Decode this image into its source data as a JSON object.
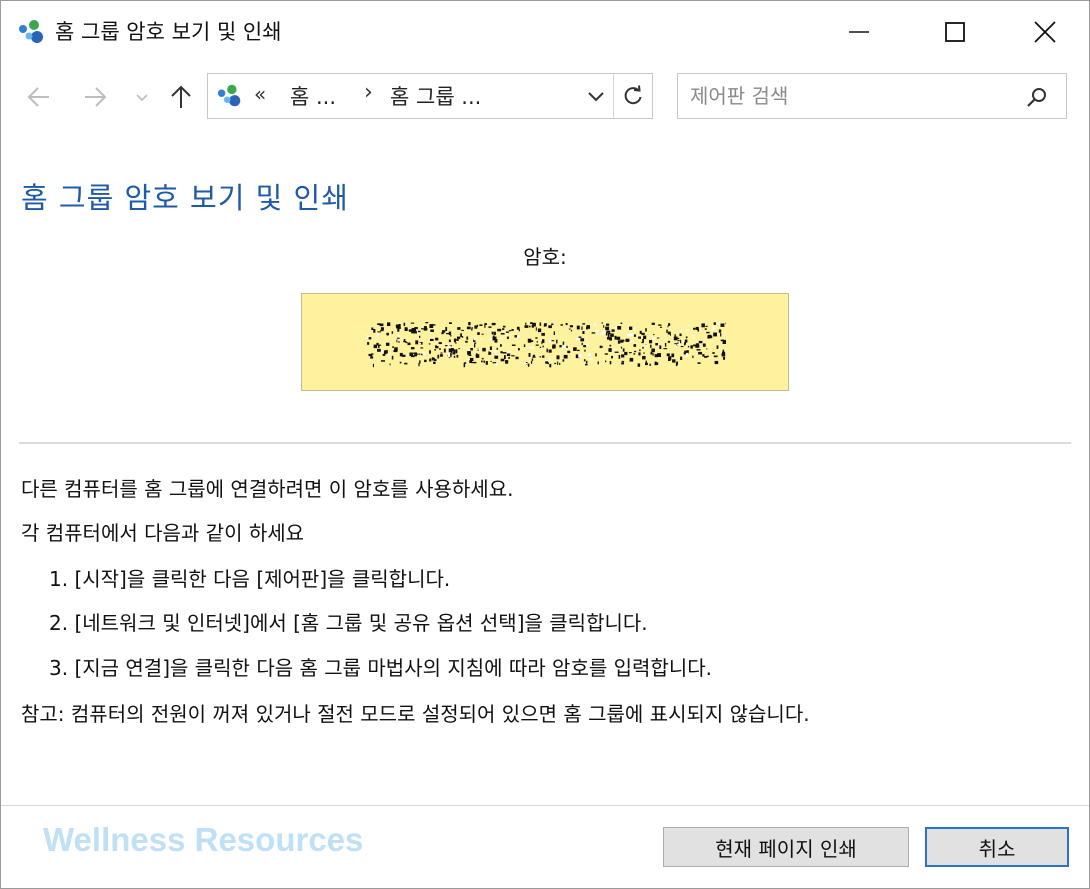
{
  "window": {
    "title": "홈 그룹 암호 보기 및 인쇄"
  },
  "nav": {
    "address_overflow": "«",
    "address_segment_1": "홈 ...",
    "address_separator": "›",
    "address_segment_2": "홈 그룹 ...",
    "search_placeholder": "제어판 검색"
  },
  "content": {
    "page_title": "홈 그룹 암호 보기 및 인쇄",
    "password_label": "암호:",
    "intro": "다른 컴퓨터를 홈 그룹에 연결하려면 이 암호를 사용하세요.",
    "each_computer": "각 컴퓨터에서 다음과 같이 하세요",
    "steps": [
      "1. [시작]을 클릭한 다음 [제어판]을 클릭합니다.",
      "2. [네트워크 및 인터넷]에서 [홈 그룹 및 공유 옵션 선택]을 클릭합니다.",
      "3. [지금 연결]을 클릭한 다음 홈 그룹 마법사의 지침에 따라 암호를 입력합니다."
    ],
    "note": "참고: 컴퓨터의 전원이 꺼져 있거나 절전 모드로 설정되어 있으면 홈 그룹에 표시되지 않습니다."
  },
  "footer": {
    "watermark": "Wellness Resources",
    "print_button": "현재 페이지 인쇄",
    "cancel_button": "취소"
  },
  "colors": {
    "title_blue": "#1e5aa8",
    "password_box": "#fff29e",
    "watermark": "#bfe0f5",
    "default_button_border": "#2a73c9"
  },
  "icons": {
    "app": "homegroup-icon",
    "minimize": "minimize-icon",
    "maximize": "maximize-icon",
    "close": "close-icon",
    "back": "arrow-left-icon",
    "forward": "arrow-right-icon",
    "recent": "chevron-down-icon",
    "up": "arrow-up-icon",
    "refresh": "refresh-icon",
    "search": "search-icon"
  }
}
